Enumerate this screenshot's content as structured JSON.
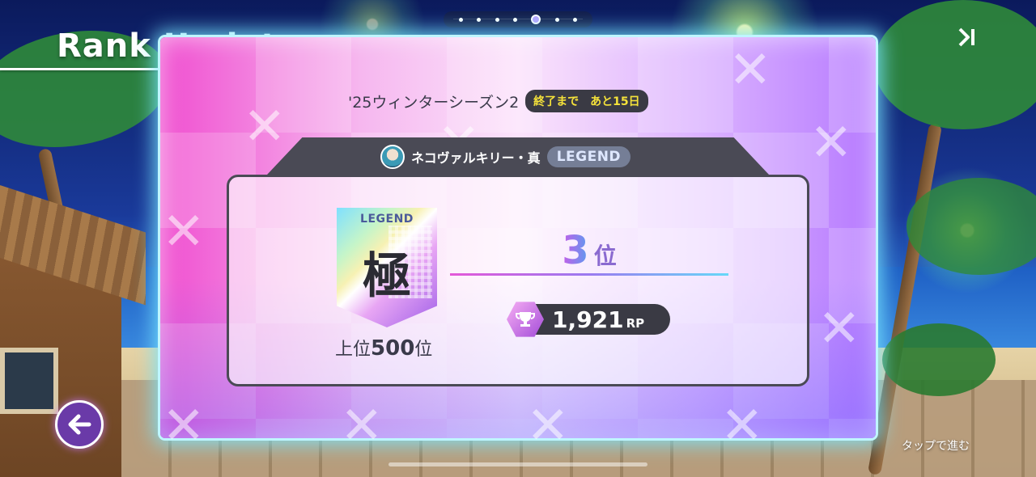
{
  "header": {
    "title": "Rank Update",
    "skip_icon": "skip-forward-icon"
  },
  "pager": {
    "count": 7,
    "active_index": 4
  },
  "season": {
    "name": "'25ウィンターシーズン2",
    "badge": "終了まで　あと15日"
  },
  "character": {
    "name": "ネコヴァルキリー・真",
    "rank": "LEGEND"
  },
  "tier": {
    "label": "LEGEND",
    "kanji": "極",
    "rank_prefix": "上位",
    "rank_number": "500",
    "rank_suffix": "位"
  },
  "placement": {
    "number": "3",
    "suffix": "位"
  },
  "points": {
    "value": "1,921",
    "unit": "RP",
    "icon": "trophy-icon"
  },
  "footer": {
    "back_icon": "back-arrow-icon",
    "tap_hint": "タップで進む"
  },
  "colors": {
    "panel_glow": "#bff6ff",
    "panel_left": "#f04fd0",
    "panel_right": "#b67aff",
    "badge_text": "#f5e23a",
    "dark_ui": "#3a3a44"
  }
}
